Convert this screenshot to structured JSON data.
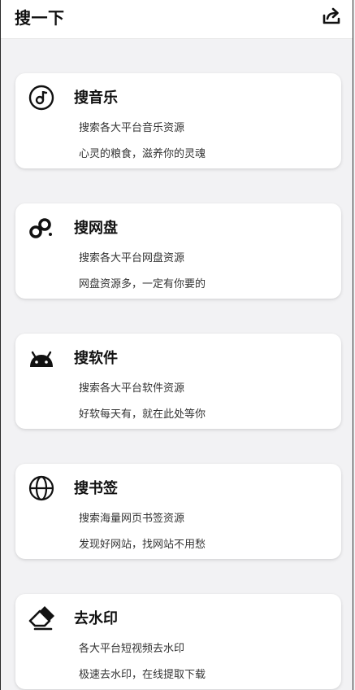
{
  "header": {
    "title": "搜一下",
    "share_icon": "share-icon"
  },
  "cards": [
    {
      "icon": "music-icon",
      "title": "搜音乐",
      "line1": "搜索各大平台音乐资源",
      "line2": "心灵的粮食，滋养你的灵魂"
    },
    {
      "icon": "baidu-pan-icon",
      "title": "搜网盘",
      "line1": "搜索各大平台网盘资源",
      "line2": "网盘资源多，一定有你要的"
    },
    {
      "icon": "android-icon",
      "title": "搜软件",
      "line1": "搜索各大平台软件资源",
      "line2": "好软每天有，就在此处等你"
    },
    {
      "icon": "globe-icon",
      "title": "搜书签",
      "line1": "搜索海量网页书签资源",
      "line2": "发现好网站，找网站不用愁"
    },
    {
      "icon": "eraser-icon",
      "title": "去水印",
      "line1": "各大平台短视频去水印",
      "line2": "极速去水印，在线提取下载"
    }
  ]
}
